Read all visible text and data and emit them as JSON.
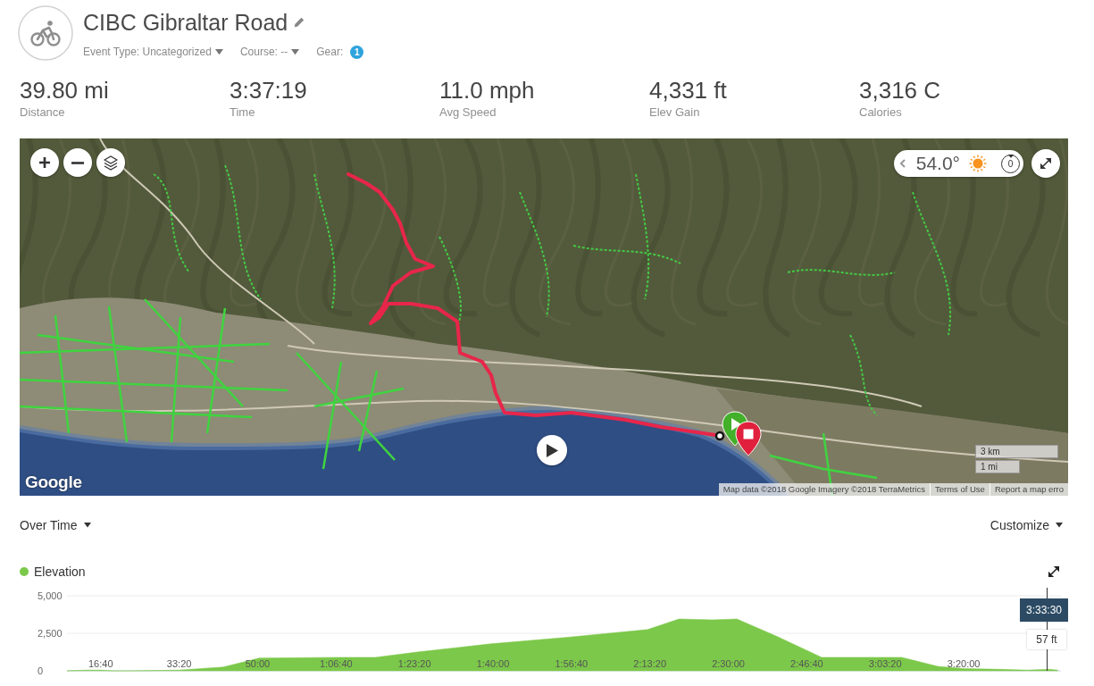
{
  "activity": {
    "title": "CIBC Gibraltar Road",
    "meta": [
      {
        "kind": "dropdown",
        "label": "Event Type:",
        "value": "Uncategorized"
      },
      {
        "kind": "dropdown",
        "label": "Course:",
        "value": "--"
      },
      {
        "kind": "count",
        "label": "Gear:",
        "value": "1"
      }
    ]
  },
  "stats": [
    {
      "value": "39.80 mi",
      "label": "Distance"
    },
    {
      "value": "3:37:19",
      "label": "Time"
    },
    {
      "value": "11.0 mph",
      "label": "Avg Speed"
    },
    {
      "value": "4,331 ft",
      "label": "Elev Gain"
    },
    {
      "value": "3,316 C",
      "label": "Calories"
    }
  ],
  "map": {
    "weather": {
      "temperature": "54.0°",
      "wind": "0"
    },
    "scale": [
      "3 km",
      "1 mi"
    ],
    "logo": "Google",
    "attribution": "Map data ©2018 Google Imagery ©2018 TerraMetrics",
    "links": [
      "Terms of Use",
      "Report a map erro"
    ]
  },
  "chart_toolbar": {
    "view": "Over Time",
    "customize": "Customize"
  },
  "elevation": {
    "chart_data": {
      "type": "area",
      "x": [
        570,
        850,
        1000,
        1150,
        1420,
        2000,
        2560,
        3020,
        4020,
        4500,
        5030,
        5970,
        6980,
        7970,
        8370,
        8800,
        9110,
        9620,
        10190,
        10990,
        11210,
        11670,
        12000,
        12470,
        12810,
        13090,
        13200
      ],
      "series": [
        {
          "name": "Elevation",
          "color": "#7cc84a",
          "values": [
            0,
            50,
            50,
            0,
            0,
            50,
            250,
            850,
            900,
            900,
            1250,
            1800,
            2250,
            2750,
            3450,
            3400,
            3450,
            2300,
            900,
            900,
            900,
            300,
            150,
            100,
            50,
            100,
            50
          ]
        }
      ],
      "xlim": [
        570,
        13240
      ],
      "ylim": [
        0,
        5000
      ],
      "xticks": [
        {
          "value": 1000,
          "label": "16:40"
        },
        {
          "value": 2000,
          "label": "33:20"
        },
        {
          "value": 3000,
          "label": "50:00"
        },
        {
          "value": 4000,
          "label": "1:06:40"
        },
        {
          "value": 5000,
          "label": "1:23:20"
        },
        {
          "value": 6000,
          "label": "1:40:00"
        },
        {
          "value": 7000,
          "label": "1:56:40"
        },
        {
          "value": 8000,
          "label": "2:13:20"
        },
        {
          "value": 9000,
          "label": "2:30:00"
        },
        {
          "value": 10000,
          "label": "2:46:40"
        },
        {
          "value": 11000,
          "label": "3:03:20"
        },
        {
          "value": 12000,
          "label": "3:20:00"
        }
      ],
      "yticks": [
        {
          "value": 0,
          "label": "0"
        },
        {
          "value": 2500,
          "label": "2,500"
        },
        {
          "value": 5000,
          "label": "5,000"
        }
      ]
    },
    "tooltip": {
      "time": "3:33:30",
      "value": "57 ft"
    }
  }
}
